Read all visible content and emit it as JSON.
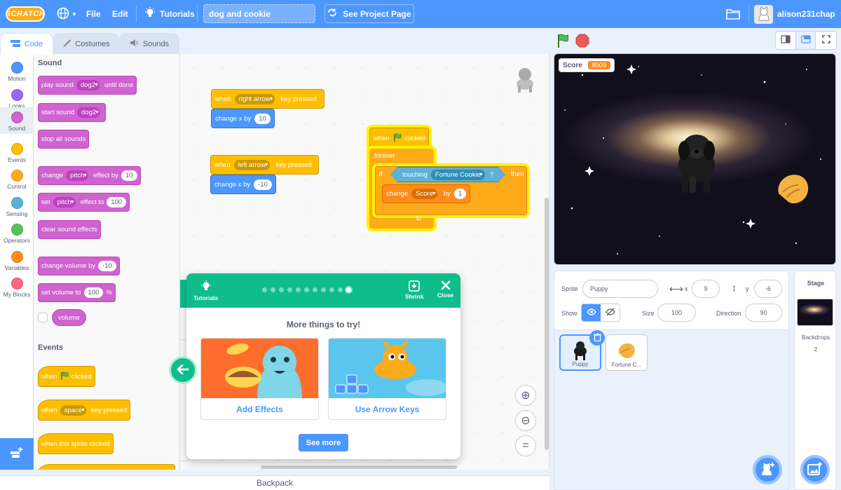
{
  "menubar": {
    "logo": "SCRATCH",
    "file": "File",
    "edit": "Edit",
    "tutorials": "Tutorials",
    "project_title": "dog and cookie",
    "see_project": "See Project Page",
    "username": "alison231chap"
  },
  "tabs": {
    "code": "Code",
    "costumes": "Costumes",
    "sounds": "Sounds"
  },
  "categories": [
    {
      "label": "Motion",
      "color": "#4c97ff"
    },
    {
      "label": "Looks",
      "color": "#9966ff"
    },
    {
      "label": "Sound",
      "color": "#cf63cf"
    },
    {
      "label": "Events",
      "color": "#ffbf00"
    },
    {
      "label": "Control",
      "color": "#ffab19"
    },
    {
      "label": "Sensing",
      "color": "#5cb1d6"
    },
    {
      "label": "Operators",
      "color": "#59c059"
    },
    {
      "label": "Variables",
      "color": "#ff8c1a"
    },
    {
      "label": "My Blocks",
      "color": "#ff6680"
    }
  ],
  "palette": {
    "sound_header": "Sound",
    "play_sound": "play sound",
    "dog2": "dog2",
    "until_done": "until done",
    "start_sound": "start sound",
    "stop_all": "stop all sounds",
    "change": "change",
    "pitch": "pitch",
    "effect_by": "effect by",
    "effect_by_val": "10",
    "set": "set",
    "effect_to": "effect to",
    "effect_to_val": "100",
    "clear_effects": "clear sound effects",
    "change_volume": "change volume by",
    "change_volume_val": "-10",
    "set_volume": "set volume to",
    "set_volume_val": "100",
    "percent": "%",
    "volume": "volume",
    "events_header": "Events",
    "when": "when",
    "clicked": "clicked",
    "space": "space",
    "key_pressed": "key pressed",
    "sprite_clicked": "when this sprite clicked"
  },
  "scripts": {
    "when": "when",
    "right_arrow": "right arrow",
    "key_pressed": "key pressed",
    "change_x_by": "change x by",
    "val_10": "10",
    "left_arrow": "left arrow",
    "val_neg10": "-10",
    "clicked": "clicked",
    "forever": "forever",
    "if": "if",
    "touching": "touching",
    "fortune_cookie": "Fortune Cookie",
    "question": "?",
    "then": "then",
    "change": "change",
    "score": "Score",
    "by": "by",
    "val_1": "1"
  },
  "tutorial": {
    "tutorials": "Tutorials",
    "shrink": "Shrink",
    "close": "Close",
    "heading": "More things to try!",
    "tile1": "Add Effects",
    "tile2": "Use Arrow Keys",
    "see_more": "See more"
  },
  "stage": {
    "monitor_label": "Score",
    "monitor_value": "8509"
  },
  "sprite_info": {
    "sprite_label": "Sprite",
    "sprite_name": "Puppy",
    "x_label": "x",
    "x_val": "9",
    "y_label": "y",
    "y_val": "-6",
    "show_label": "Show",
    "size_label": "Size",
    "size_val": "100",
    "direction_label": "Direction",
    "direction_val": "90"
  },
  "sprites": [
    {
      "name": "Puppy"
    },
    {
      "name": "Fortune C..."
    }
  ],
  "stage_panel": {
    "title": "Stage",
    "backdrops_label": "Backdrops",
    "backdrops_count": "2"
  },
  "backpack": "Backpack"
}
